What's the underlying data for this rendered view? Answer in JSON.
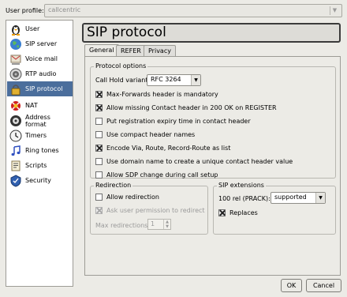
{
  "profile": {
    "label": "User profile:",
    "value": "callcentric"
  },
  "sidebar": {
    "items": [
      {
        "label": "User",
        "icon": "user-icon",
        "selected": false
      },
      {
        "label": "SIP server",
        "icon": "globe-icon",
        "selected": false
      },
      {
        "label": "Voice mail",
        "icon": "voicemail-icon",
        "selected": false
      },
      {
        "label": "RTP audio",
        "icon": "speaker-icon",
        "selected": false
      },
      {
        "label": "SIP protocol",
        "icon": "lock-icon",
        "selected": true
      },
      {
        "label": "NAT",
        "icon": "nat-icon",
        "selected": false
      },
      {
        "label": "Address format",
        "icon": "phone-icon",
        "selected": false
      },
      {
        "label": "Timers",
        "icon": "clock-icon",
        "selected": false
      },
      {
        "label": "Ring tones",
        "icon": "music-note-icon",
        "selected": false
      },
      {
        "label": "Scripts",
        "icon": "script-icon",
        "selected": false
      },
      {
        "label": "Security",
        "icon": "shield-icon",
        "selected": false
      }
    ]
  },
  "panel": {
    "title": "SIP protocol",
    "tabs": [
      {
        "label": "General",
        "active": true
      },
      {
        "label": "REFER",
        "active": false
      },
      {
        "label": "Privacy",
        "active": false
      }
    ]
  },
  "protocol_options": {
    "title": "Protocol options",
    "call_hold_label": "Call Hold variant:",
    "call_hold_value": "RFC 3264",
    "options": [
      {
        "label": "Max-Forwards header is mandatory",
        "checked": true
      },
      {
        "label": "Allow missing Contact header in 200 OK on REGISTER",
        "checked": true
      },
      {
        "label": "Put registration expiry time in contact header",
        "checked": false
      },
      {
        "label": "Use compact header names",
        "checked": false
      },
      {
        "label": "Encode Via, Route, Record-Route as list",
        "checked": true
      },
      {
        "label": "Use domain name to create a unique contact header value",
        "checked": false
      },
      {
        "label": "Allow SDP change during call setup",
        "checked": false
      }
    ]
  },
  "redirection": {
    "title": "Redirection",
    "allow_label": "Allow redirection",
    "allow_checked": false,
    "ask_label": "Ask user permission to redirect",
    "ask_checked": true,
    "max_label": "Max redirections:",
    "max_value": "1"
  },
  "sip_extensions": {
    "title": "SIP extensions",
    "rel_label": "100 rel (PRACK):",
    "rel_value": "supported",
    "replaces_label": "Replaces",
    "replaces_checked": true
  },
  "buttons": {
    "ok": "OK",
    "cancel": "Cancel"
  },
  "colors": {
    "selection": "#4b6e9c",
    "window_bg": "#ecebe6"
  }
}
